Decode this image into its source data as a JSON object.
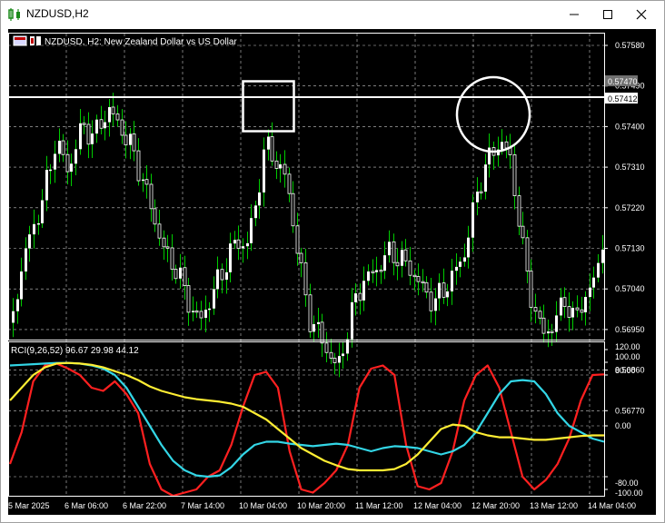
{
  "window": {
    "title": "NZDUSD,H2",
    "minimize_icon": "minimize-icon",
    "maximize_icon": "maximize-icon",
    "close_icon": "close-icon"
  },
  "chart_header": {
    "symbol_text": "NZDUSD, H2:  New Zealand Dollar vs US Dollar"
  },
  "indicator": {
    "label": "RCI(9,26,52) 96.67 29.98 44.12"
  },
  "colors": {
    "background": "#000000",
    "grid": "#c8c8c8",
    "bull_candle": "#ffffff",
    "wick": "#00cc00",
    "rci_short": "#ff2020",
    "rci_mid": "#33d6e6",
    "rci_long": "#ffee33",
    "annotation": "#ffffff"
  },
  "price_axis": {
    "ticks": [
      "0.57580",
      "0.57490",
      "0.57400",
      "0.57310",
      "0.57220",
      "0.57130",
      "0.57040",
      "0.56950",
      "0.56860",
      "0.56770"
    ],
    "tag_upper": "0.57470",
    "tag_line": "0.57412"
  },
  "rci_axis": {
    "ticks": [
      "120.00",
      "100.00",
      "80.00",
      "0.00",
      "-80.00",
      "-100.00"
    ]
  },
  "time_axis": {
    "labels": [
      "5 Mar 2025",
      "6 Mar 06:00",
      "6 Mar 22:00",
      "7 Mar 14:00",
      "10 Mar 04:00",
      "10 Mar 20:00",
      "11 Mar 12:00",
      "12 Mar 04:00",
      "12 Mar 20:00",
      "13 Mar 12:00",
      "14 Mar 04:00"
    ]
  },
  "chart_data": {
    "type": "candlestick",
    "price_range": [
      0.5673,
      0.5762
    ],
    "horizontal_line": 0.57412,
    "rci_range": [
      -120,
      120
    ],
    "rci_series": [
      {
        "name": "RCI(9)",
        "color": "#ff2020",
        "values": [
          -60,
          -10,
          70,
          95,
          98,
          90,
          80,
          60,
          55,
          70,
          50,
          20,
          -60,
          -100,
          -110,
          -105,
          -100,
          -80,
          -70,
          -30,
          30,
          80,
          85,
          60,
          -40,
          -100,
          -105,
          -90,
          -70,
          -30,
          60,
          90,
          95,
          80,
          -30,
          -95,
          -100,
          -90,
          -40,
          40,
          80,
          95,
          60,
          -10,
          -80,
          -100,
          -85,
          -60,
          -20,
          40,
          80,
          81
        ]
      },
      {
        "name": "RCI(26)",
        "color": "#33d6e6",
        "values": [
          95,
          96,
          97,
          98,
          99,
          99,
          98,
          95,
          90,
          80,
          60,
          30,
          0,
          -30,
          -55,
          -70,
          -78,
          -80,
          -78,
          -65,
          -45,
          -30,
          -25,
          -25,
          -28,
          -30,
          -32,
          -30,
          -28,
          -30,
          -35,
          -40,
          -35,
          -32,
          -33,
          -35,
          -40,
          -45,
          -40,
          -30,
          -10,
          20,
          50,
          70,
          72,
          70,
          50,
          20,
          0,
          -10,
          -20,
          -25
        ]
      },
      {
        "name": "RCI(52)",
        "color": "#ffee33",
        "values": [
          40,
          60,
          80,
          92,
          98,
          99,
          98,
          96,
          92,
          86,
          80,
          72,
          62,
          55,
          50,
          45,
          42,
          40,
          38,
          35,
          30,
          20,
          10,
          -5,
          -20,
          -35,
          -45,
          -55,
          -62,
          -68,
          -70,
          -70,
          -70,
          -68,
          -60,
          -45,
          -25,
          -5,
          2,
          0,
          -10,
          -15,
          -18,
          -18,
          -20,
          -22,
          -22,
          -20,
          -18,
          -16,
          -15,
          -15
        ]
      }
    ]
  }
}
